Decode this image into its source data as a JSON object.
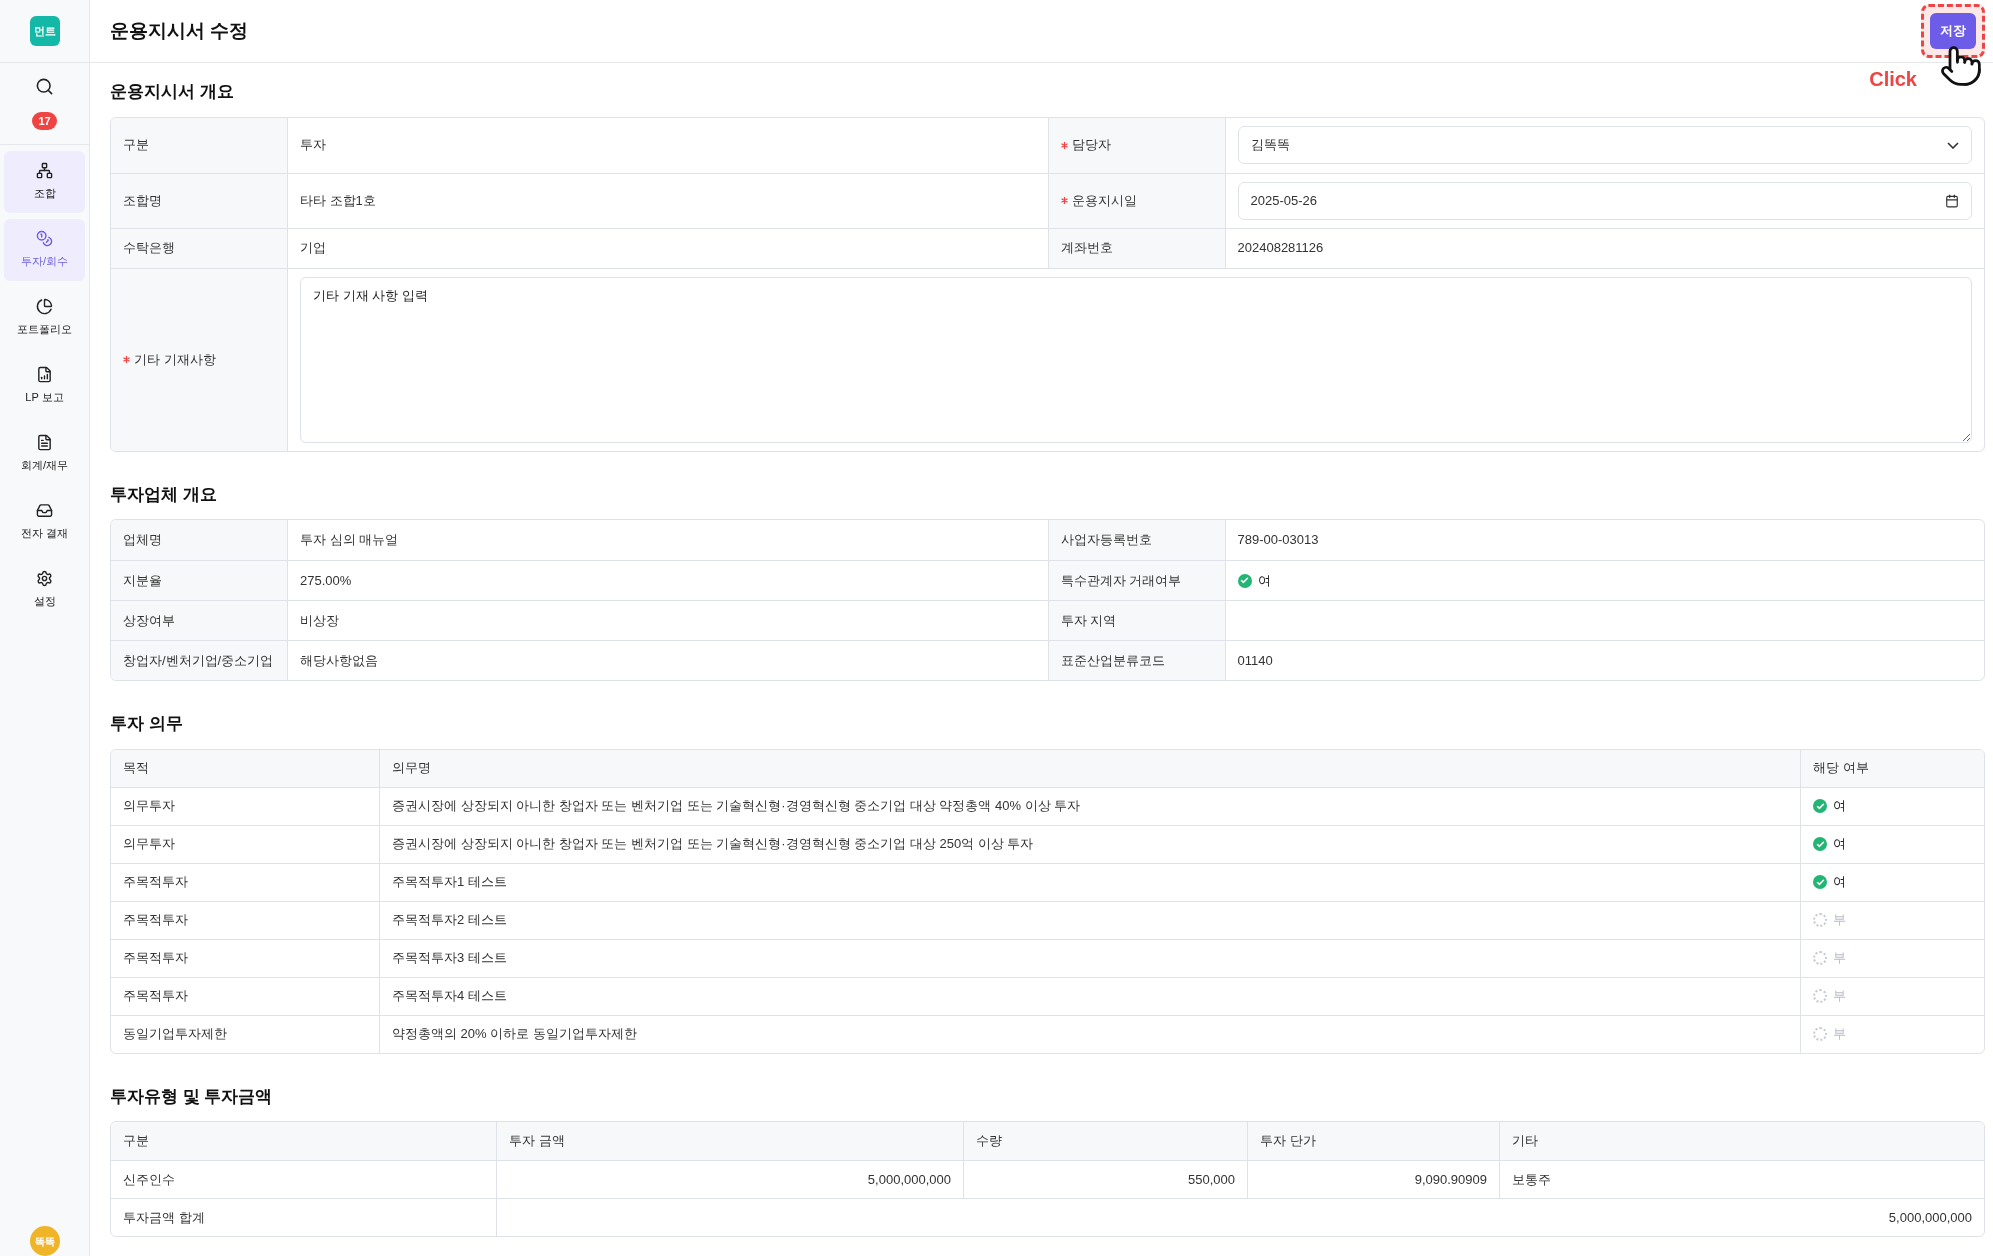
{
  "sidebar": {
    "logo": "먼트",
    "badge": "17",
    "items": [
      {
        "label": "조합",
        "selected": false,
        "highlighted": true
      },
      {
        "label": "투자/회수",
        "selected": true,
        "highlighted": true
      },
      {
        "label": "포트폴리오",
        "selected": false,
        "highlighted": false
      },
      {
        "label": "LP 보고",
        "selected": false,
        "highlighted": false
      },
      {
        "label": "회계/재무",
        "selected": false,
        "highlighted": false
      },
      {
        "label": "전자 결재",
        "selected": false,
        "highlighted": false
      },
      {
        "label": "설정",
        "selected": false,
        "highlighted": false
      }
    ],
    "avatar": "똑똑"
  },
  "header": {
    "title": "운용지시서 수정",
    "save_button": "저장",
    "annotation": "Click"
  },
  "overview": {
    "title": "운용지시서 개요",
    "rows": [
      {
        "cells": [
          {
            "label": "구분",
            "required": false,
            "kind": "text",
            "value": "투자"
          },
          {
            "label": "담당자",
            "required": true,
            "kind": "select",
            "value": "김똑똑"
          }
        ]
      },
      {
        "cells": [
          {
            "label": "조합명",
            "required": false,
            "kind": "text",
            "value": "타타 조합1호"
          },
          {
            "label": "운용지시일",
            "required": true,
            "kind": "date",
            "value": "2025-05-26"
          }
        ]
      },
      {
        "cells": [
          {
            "label": "수탁은행",
            "required": false,
            "kind": "text",
            "value": "기업"
          },
          {
            "label": "계좌번호",
            "required": false,
            "kind": "text",
            "value": "202408281126"
          }
        ]
      },
      {
        "cells": [
          {
            "label": "기타 기재사항",
            "required": true,
            "kind": "textarea",
            "value": "기타 기재 사항 입력"
          }
        ]
      }
    ]
  },
  "company": {
    "title": "투자업체 개요",
    "rows": [
      {
        "cells": [
          {
            "label": "업체명",
            "kind": "text",
            "value": "투자 심의 매뉴얼"
          },
          {
            "label": "사업자등록번호",
            "kind": "text",
            "value": "789-00-03013"
          }
        ]
      },
      {
        "cells": [
          {
            "label": "지분율",
            "kind": "text",
            "value": "275.00%"
          },
          {
            "label": "특수관계자 거래여부",
            "kind": "status",
            "checked": true,
            "value": "여"
          }
        ]
      },
      {
        "cells": [
          {
            "label": "상장여부",
            "kind": "text",
            "value": "비상장"
          },
          {
            "label": "투자 지역",
            "kind": "text"
          }
        ]
      },
      {
        "cells": [
          {
            "label": "창업자/벤처기업/중소기업",
            "kind": "text",
            "value": "해당사항없음"
          },
          {
            "label": "표준산업분류코드",
            "kind": "text",
            "value": "01140"
          }
        ]
      }
    ]
  },
  "obligations": {
    "title": "투자 의무",
    "columns": [
      "목적",
      "의무명",
      "해당 여부"
    ],
    "rows": [
      {
        "purpose": "의무투자",
        "name": "증권시장에 상장되지 아니한 창업자 또는 벤처기업 또는 기술혁신형·경영혁신형 중소기업 대상 약정총액 40% 이상 투자",
        "checked": true,
        "status": "여"
      },
      {
        "purpose": "의무투자",
        "name": "증권시장에 상장되지 아니한 창업자 또는 벤처기업 또는 기술혁신형·경영혁신형 중소기업 대상 250억 이상 투자",
        "checked": true,
        "status": "여"
      },
      {
        "purpose": "주목적투자",
        "name": "주목적투자1 테스트",
        "checked": true,
        "status": "여"
      },
      {
        "purpose": "주목적투자",
        "name": "주목적투자2 테스트",
        "checked": false,
        "status": "부"
      },
      {
        "purpose": "주목적투자",
        "name": "주목적투자3 테스트",
        "checked": false,
        "status": "부"
      },
      {
        "purpose": "주목적투자",
        "name": "주목적투자4 테스트",
        "checked": false,
        "status": "부"
      },
      {
        "purpose": "동일기업투자제한",
        "name": "약정총액의 20% 이하로 동일기업투자제한",
        "checked": false,
        "status": "부"
      }
    ]
  },
  "investment": {
    "title": "투자유형 및 투자금액",
    "columns": [
      "구분",
      "투자 금액",
      "수량",
      "투자 단가",
      "기타"
    ],
    "rows": [
      {
        "cells": [
          "신주인수",
          "5,000,000,000",
          "550,000",
          "9,090.90909",
          "보통주"
        ]
      }
    ],
    "total": {
      "label": "투자금액 합계",
      "value": "5,000,000,000"
    }
  }
}
